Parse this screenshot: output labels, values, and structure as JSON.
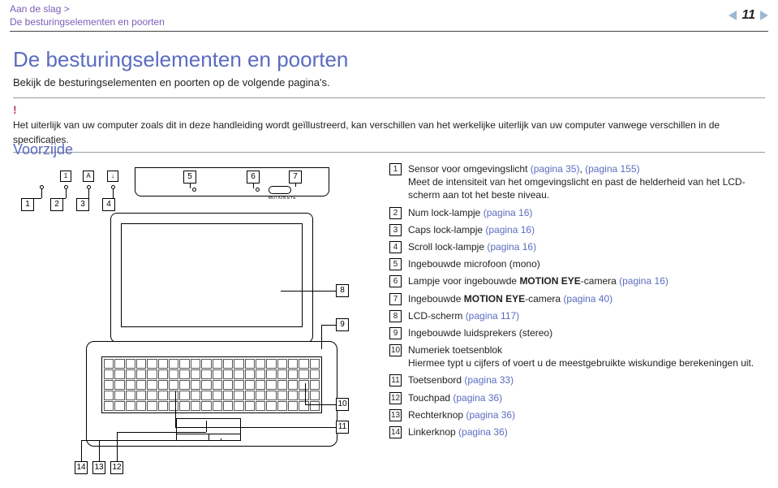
{
  "header": {
    "breadcrumb_line1": "Aan de slag >",
    "breadcrumb_line2": "De besturingselementen en poorten",
    "page_number": "11"
  },
  "page": {
    "title": "De besturingselementen en poorten",
    "subtitle": "Bekijk de besturingselementen en poorten op de volgende pagina's.",
    "notice_mark": "!",
    "notice_text": "Het uiterlijk van uw computer zoals dit in deze handleiding wordt geïllustreerd, kan verschillen van het werkelijke uiterlijk van uw computer vanwege verschillen in de specificaties.",
    "section_heading": "Voorzijde"
  },
  "diagram": {
    "key_indicators": [
      "1",
      "A",
      "↓"
    ],
    "camera_label": "MOTION EYE",
    "callouts": [
      "1",
      "2",
      "3",
      "4",
      "5",
      "6",
      "7",
      "8",
      "9",
      "10",
      "11",
      "12",
      "13",
      "14"
    ]
  },
  "legend": [
    {
      "num": "1",
      "text": "Sensor voor omgevingslicht ",
      "link": "(pagina 35)",
      "sep": ", ",
      "link2": "(pagina 155)",
      "sub": "Meet de intensiteit van het omgevingslicht en past de helderheid van het LCD-scherm aan tot het beste niveau."
    },
    {
      "num": "2",
      "text": "Num lock-lampje ",
      "link": "(pagina 16)"
    },
    {
      "num": "3",
      "text": "Caps lock-lampje ",
      "link": "(pagina 16)"
    },
    {
      "num": "4",
      "text": "Scroll lock-lampje ",
      "link": "(pagina 16)"
    },
    {
      "num": "5",
      "text": "Ingebouwde microfoon (mono)"
    },
    {
      "num": "6",
      "text": "Lampje voor ingebouwde ",
      "bold": "MOTION EYE",
      "text2": "-camera ",
      "link": "(pagina 16)"
    },
    {
      "num": "7",
      "text": "Ingebouwde ",
      "bold": "MOTION EYE",
      "text2": "-camera ",
      "link": "(pagina 40)"
    },
    {
      "num": "8",
      "text": "LCD-scherm ",
      "link": "(pagina 117)"
    },
    {
      "num": "9",
      "text": "Ingebouwde luidsprekers (stereo)"
    },
    {
      "num": "10",
      "text": "Numeriek toetsenblok",
      "sub": "Hiermee typt u cijfers of voert u de meestgebruikte wiskundige berekeningen uit."
    },
    {
      "num": "11",
      "text": "Toetsenbord ",
      "link": "(pagina 33)"
    },
    {
      "num": "12",
      "text": "Touchpad ",
      "link": "(pagina 36)"
    },
    {
      "num": "13",
      "text": "Rechterknop ",
      "link": "(pagina 36)"
    },
    {
      "num": "14",
      "text": "Linkerknop ",
      "link": "(pagina 36)"
    }
  ]
}
